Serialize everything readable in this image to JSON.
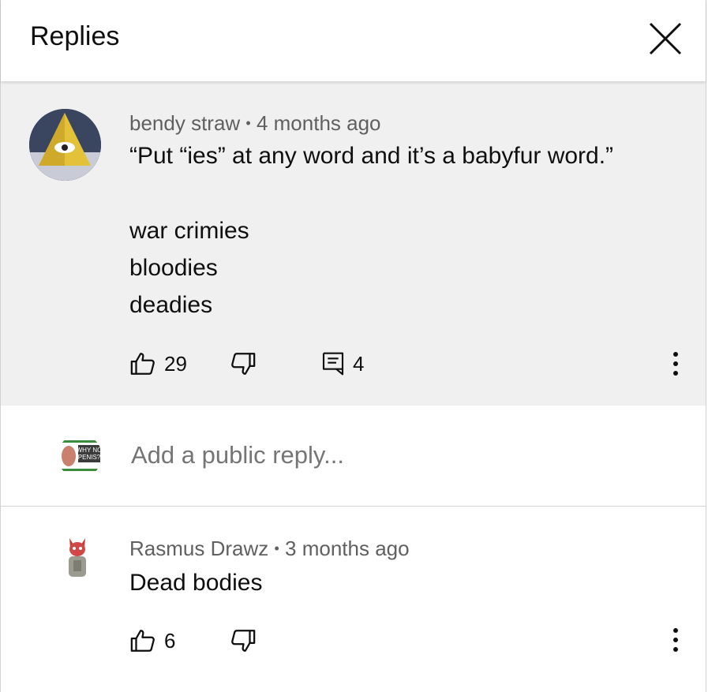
{
  "header": {
    "title": "Replies"
  },
  "top_comment": {
    "author": "bendy straw",
    "separator": "•",
    "time": "4 months ago",
    "text": "“Put “ies” at any word and it’s a babyfur word.”",
    "lines": [
      "war crimies",
      "bloodies",
      "deadies"
    ],
    "likes": "29",
    "replies": "4"
  },
  "reply_box": {
    "placeholder": "Add a public reply...",
    "avatar_text_1": "WHY NO",
    "avatar_text_2": "PENIS?"
  },
  "replies": [
    {
      "author": "Rasmus Drawz",
      "separator": "•",
      "time": "3 months ago",
      "text": "Dead bodies",
      "likes": "6"
    }
  ],
  "colors": {
    "highlight_bg": "#f0f0f0",
    "secondary_text": "#606060",
    "primary_text": "#0f0f0f"
  }
}
